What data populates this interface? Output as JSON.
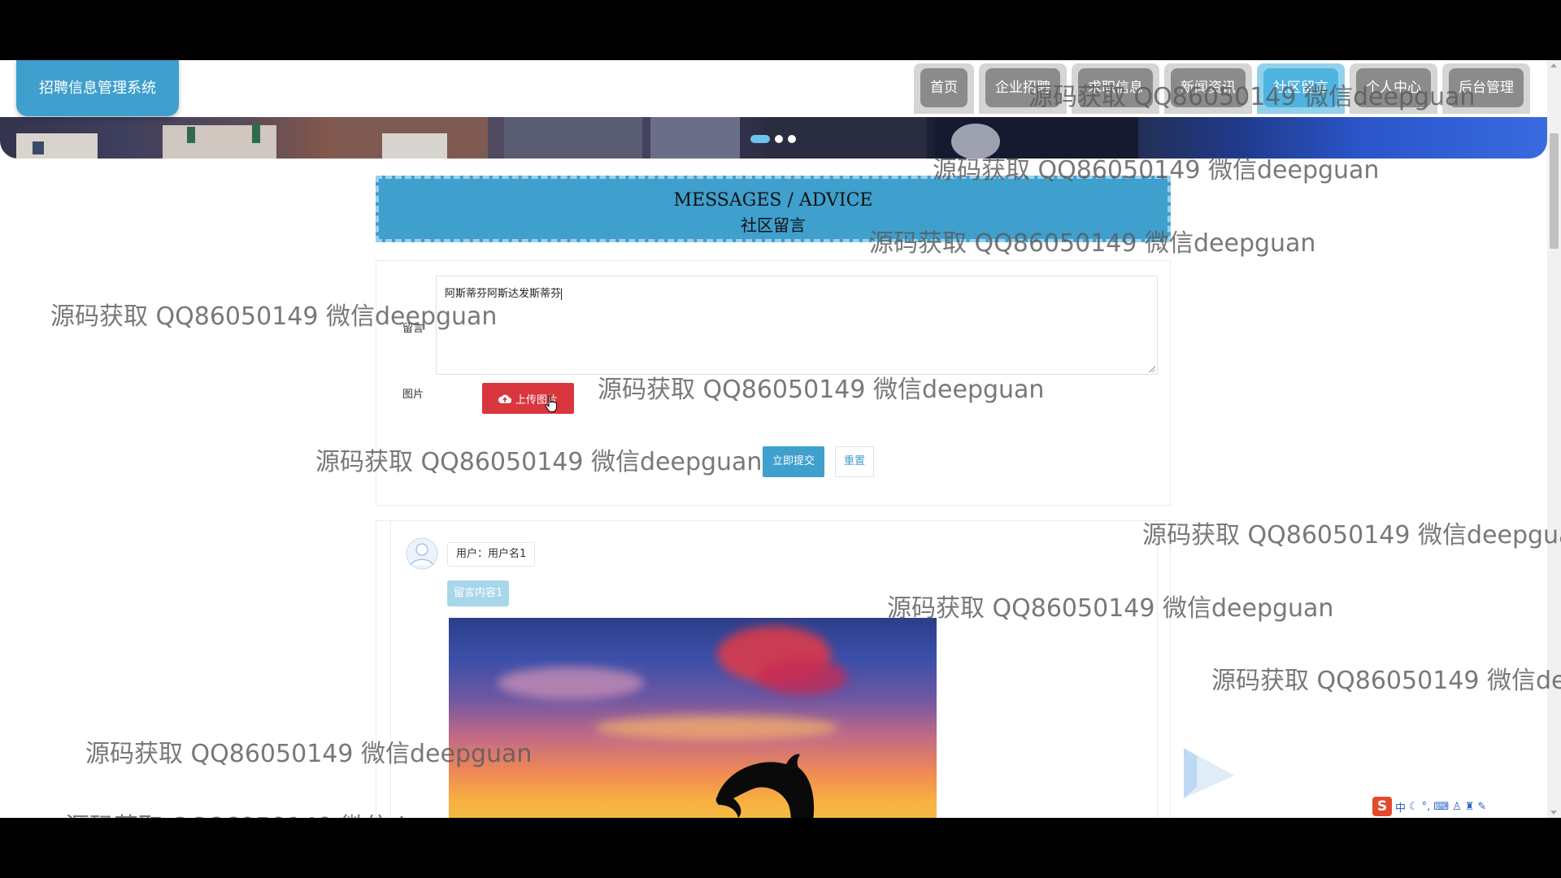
{
  "app": {
    "title": "招聘信息管理系统"
  },
  "nav": {
    "items": [
      {
        "label": "首页",
        "active": false
      },
      {
        "label": "企业招聘",
        "active": false
      },
      {
        "label": "求职信息",
        "active": false
      },
      {
        "label": "新闻资讯",
        "active": false
      },
      {
        "label": "社区留言",
        "active": true
      },
      {
        "label": "个人中心",
        "active": false
      },
      {
        "label": "后台管理",
        "active": false
      }
    ]
  },
  "page": {
    "title_en": "MESSAGES / ADVICE",
    "title_cn": "社区留言"
  },
  "form": {
    "message_label": "留言",
    "message_value": "阿斯蒂芬阿斯达发斯蒂芬",
    "image_label": "图片",
    "upload_label": "上传图片",
    "submit_label": "立即提交",
    "reset_label": "重置"
  },
  "comments": [
    {
      "user": "用户：用户名1",
      "content": "留言内容1"
    }
  ],
  "watermark": "源码获取 QQ86050149 微信deepguan",
  "ime": {
    "label": "中"
  },
  "colors": {
    "accent": "#3f9fcd",
    "upload": "#d9363e",
    "nav_inactive": "#8b8b8b",
    "nav_active": "#4fb3e0"
  }
}
